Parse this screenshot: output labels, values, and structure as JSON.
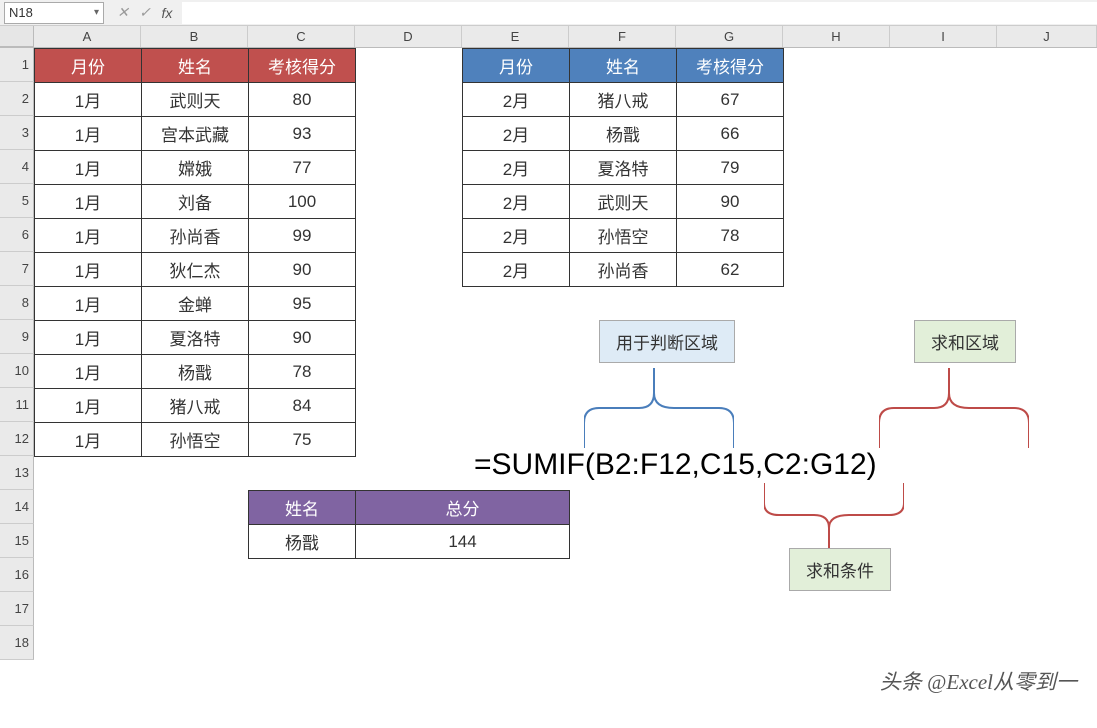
{
  "formulaBar": {
    "nameBox": "N18",
    "fxLabel": "fx",
    "cancel": "✕",
    "accept": "✓",
    "formula": ""
  },
  "columns": [
    "A",
    "B",
    "C",
    "D",
    "E",
    "F",
    "G",
    "H",
    "I",
    "J"
  ],
  "rows": [
    "1",
    "2",
    "3",
    "4",
    "5",
    "6",
    "7",
    "8",
    "9",
    "10",
    "11",
    "12",
    "13",
    "14",
    "15",
    "16",
    "17",
    "18"
  ],
  "table1": {
    "headers": [
      "月份",
      "姓名",
      "考核得分"
    ],
    "rows": [
      [
        "1月",
        "武则天",
        "80"
      ],
      [
        "1月",
        "宫本武藏",
        "93"
      ],
      [
        "1月",
        "嫦娥",
        "77"
      ],
      [
        "1月",
        "刘备",
        "100"
      ],
      [
        "1月",
        "孙尚香",
        "99"
      ],
      [
        "1月",
        "狄仁杰",
        "90"
      ],
      [
        "1月",
        "金蝉",
        "95"
      ],
      [
        "1月",
        "夏洛特",
        "90"
      ],
      [
        "1月",
        "杨戬",
        "78"
      ],
      [
        "1月",
        "猪八戒",
        "84"
      ],
      [
        "1月",
        "孙悟空",
        "75"
      ]
    ]
  },
  "table2": {
    "headers": [
      "月份",
      "姓名",
      "考核得分"
    ],
    "rows": [
      [
        "2月",
        "猪八戒",
        "67"
      ],
      [
        "2月",
        "杨戬",
        "66"
      ],
      [
        "2月",
        "夏洛特",
        "79"
      ],
      [
        "2月",
        "武则天",
        "90"
      ],
      [
        "2月",
        "孙悟空",
        "78"
      ],
      [
        "2月",
        "孙尚香",
        "62"
      ]
    ]
  },
  "table3": {
    "headers": [
      "姓名",
      "总分"
    ],
    "rows": [
      [
        "杨戬",
        "144"
      ]
    ]
  },
  "annotation": {
    "box1": "用于判断区域",
    "box2": "求和区域",
    "box3": "求和条件",
    "formulaDisplay": "=SUMIF(B2:F12,C15,C2:G12)"
  },
  "watermark": "头条 @Excel从零到一",
  "colors": {
    "table1Header": "#c0504e",
    "table2Header": "#4f81bc",
    "table3Header": "#8064a2",
    "blueBox": "#deebf6",
    "greenBox": "#e2efd9",
    "braceBlue": "#4a7ebb",
    "braceRed": "#be4b48"
  }
}
